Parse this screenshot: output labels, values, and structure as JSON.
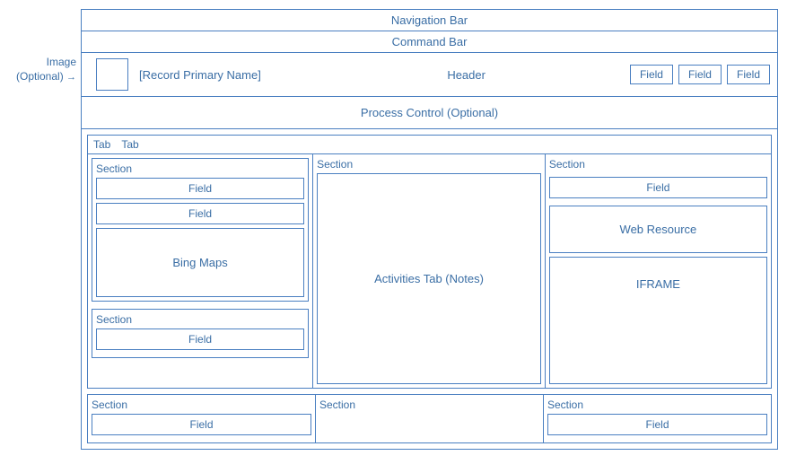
{
  "bars": {
    "navigation": "Navigation Bar",
    "command": "Command Bar"
  },
  "header": {
    "image_label": "Image\n(Optional)",
    "record_primary_name": "[Record Primary Name]",
    "center_label": "Header",
    "fields": [
      "Field",
      "Field",
      "Field"
    ]
  },
  "process_control": "Process Control (Optional)",
  "tabs": {
    "tab1": "Tab",
    "tab2": "Tab"
  },
  "columns": {
    "left": {
      "section_label": "Section",
      "field1": "Field",
      "field2": "Field",
      "bing_maps": "Bing Maps",
      "section2_label": "Section",
      "field3": "Field"
    },
    "mid": {
      "section_label": "Section",
      "activities_tab": "Activities Tab (Notes)"
    },
    "right": {
      "section_label": "Section",
      "field1": "Field",
      "web_resource": "Web Resource",
      "iframe": "IFRAME"
    }
  },
  "bottom": {
    "section1_label": "Section",
    "section1_field": "Field",
    "section2_label": "Section",
    "section3_label": "Section",
    "section3_field": "Field"
  }
}
